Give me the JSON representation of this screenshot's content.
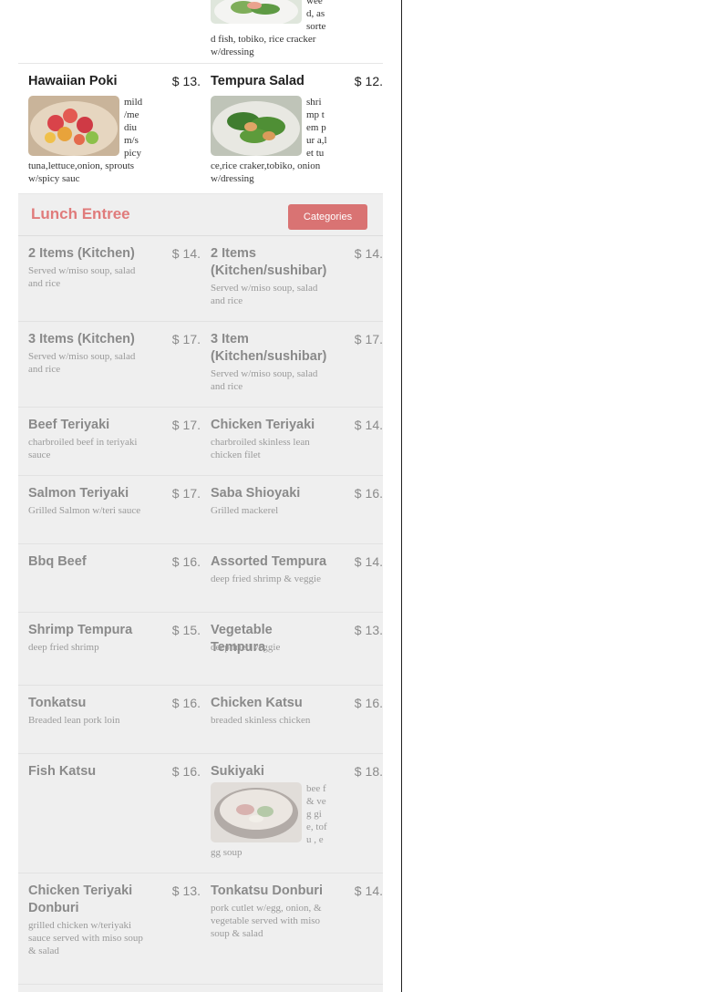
{
  "colors": {
    "accent": "#e07b7b",
    "button_bg": "#d97373",
    "grey_row": "#efefef"
  },
  "top_row": {
    "right_desc_tail": "wee d, assorted fish, tobiko, rice cracker w/dressing"
  },
  "poki_row": {
    "left": {
      "name": "Hawaiian Poki",
      "currency": "$",
      "price": "13.",
      "desc": "mild /me diu m/s picy tuna,lettuce,onion, sprouts w/spicy sauc",
      "image_icon": "poki-bowl-photo"
    },
    "right": {
      "name": "Tempura Salad",
      "currency": "$",
      "price": "12.",
      "desc": "shri mp tem pur a,let tuce,rice craker,tobiko, onion w/dressing",
      "image_icon": "tempura-salad-photo"
    }
  },
  "section": {
    "title": "Lunch Entree",
    "button": "Categories"
  },
  "items": [
    {
      "left": {
        "name": "2 Items (Kitchen)",
        "currency": "$",
        "price": "14.",
        "desc": "Served w/miso soup, salad and rice"
      },
      "right": {
        "name": "2 Items (Kitchen/sushibar)",
        "currency": "$",
        "price": "14.",
        "desc": "Served w/miso soup, salad and rice"
      }
    },
    {
      "left": {
        "name": "3 Items (Kitchen)",
        "currency": "$",
        "price": "17.",
        "desc": "Served w/miso soup, salad and rice"
      },
      "right": {
        "name": "3 Item (Kitchen/sushibar)",
        "currency": "$",
        "price": "17.",
        "desc": "Served w/miso soup, salad and rice"
      }
    },
    {
      "left": {
        "name": "Beef Teriyaki",
        "currency": "$",
        "price": "17.",
        "desc": "charbroiled beef in teriyaki sauce"
      },
      "right": {
        "name": "Chicken Teriyaki",
        "currency": "$",
        "price": "14.",
        "desc": "charbroiled skinless lean chicken filet"
      }
    },
    {
      "left": {
        "name": "Salmon Teriyaki",
        "currency": "$",
        "price": "17.",
        "desc": "Grilled Salmon w/teri sauce"
      },
      "right": {
        "name": "Saba Shioyaki",
        "currency": "$",
        "price": "16.",
        "desc": "Grilled mackerel"
      }
    },
    {
      "left": {
        "name": "Bbq Beef",
        "currency": "$",
        "price": "16.",
        "desc": ""
      },
      "right": {
        "name": "Assorted Tempura",
        "currency": "$",
        "price": "14.",
        "desc": "deep fried shrimp & veggie"
      }
    },
    {
      "left": {
        "name": "Shrimp Tempura",
        "currency": "$",
        "price": "15.",
        "desc": "deep fried shrimp"
      },
      "right": {
        "name": "Vegetable Tempura",
        "currency": "$",
        "price": "13.",
        "desc": "deep fried veggie"
      }
    },
    {
      "left": {
        "name": "Tonkatsu",
        "currency": "$",
        "price": "16.",
        "desc": "Breaded lean pork loin"
      },
      "right": {
        "name": "Chicken Katsu",
        "currency": "$",
        "price": "16.",
        "desc": "breaded skinless chicken"
      }
    },
    {
      "left": {
        "name": "Fish Katsu",
        "currency": "$",
        "price": "16.",
        "desc": ""
      },
      "right": {
        "name": "Sukiyaki",
        "currency": "$",
        "price": "18.",
        "desc": "bee f & veg gie, tofu , egg soup",
        "image_icon": "sukiyaki-pot-photo"
      }
    },
    {
      "left": {
        "name": "Chicken Teriyaki Donburi",
        "currency": "$",
        "price": "13.",
        "desc": "grilled chicken w/teriyaki sauce served with miso soup & salad"
      },
      "right": {
        "name": "Tonkatsu Donburi",
        "currency": "$",
        "price": "14.",
        "desc": "pork cutlet w/egg, onion, & vegetable served with miso soup & salad"
      }
    }
  ]
}
